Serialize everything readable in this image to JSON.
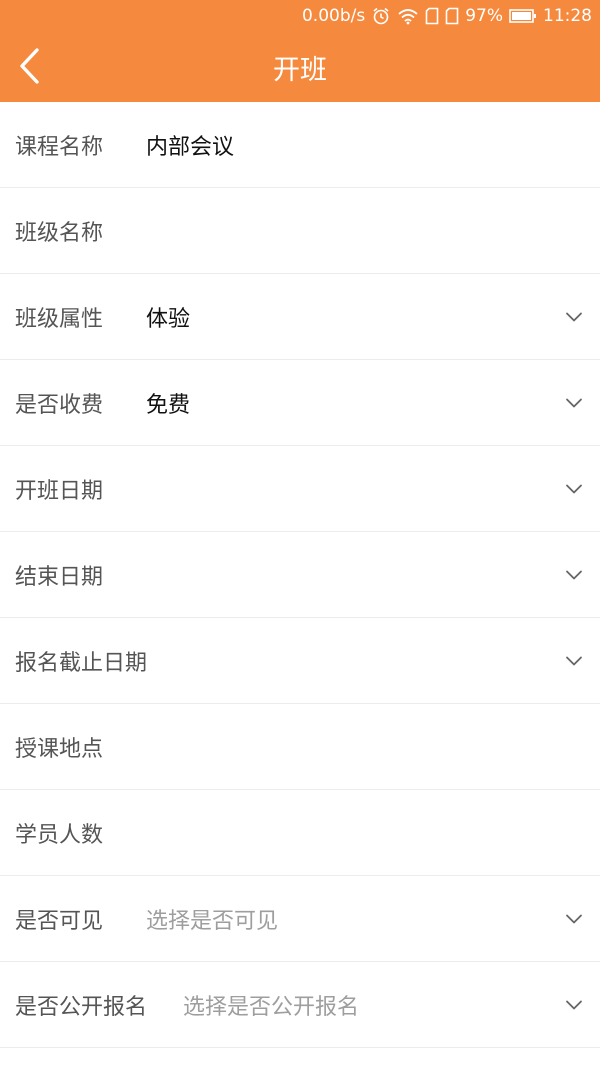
{
  "status": {
    "net_speed": "0.00b/s",
    "battery_percent": "97%",
    "time": "11:28",
    "icons": [
      "alarm-icon",
      "wifi-icon",
      "sim-icon",
      "sim-icon",
      "battery-icon"
    ]
  },
  "header": {
    "title": "开班",
    "back_icon": "chevron-left-icon"
  },
  "colors": {
    "header_bg": "#f58a3f",
    "label": "#555555",
    "value": "#111111",
    "placeholder": "#9e9e9e"
  },
  "form": {
    "course_name": {
      "label": "课程名称",
      "value": "内部会议"
    },
    "class_name": {
      "label": "班级名称"
    },
    "class_attr": {
      "label": "班级属性",
      "value": "体验"
    },
    "fee": {
      "label": "是否收费",
      "value": "免费"
    },
    "start_date": {
      "label": "开班日期"
    },
    "end_date": {
      "label": "结束日期"
    },
    "deadline": {
      "label": "报名截止日期"
    },
    "location": {
      "label": "授课地点"
    },
    "students": {
      "label": "学员人数"
    },
    "visible": {
      "label": "是否可见",
      "placeholder": "选择是否可见"
    },
    "public_signup": {
      "label": "是否公开报名",
      "placeholder": "选择是否公开报名"
    }
  }
}
